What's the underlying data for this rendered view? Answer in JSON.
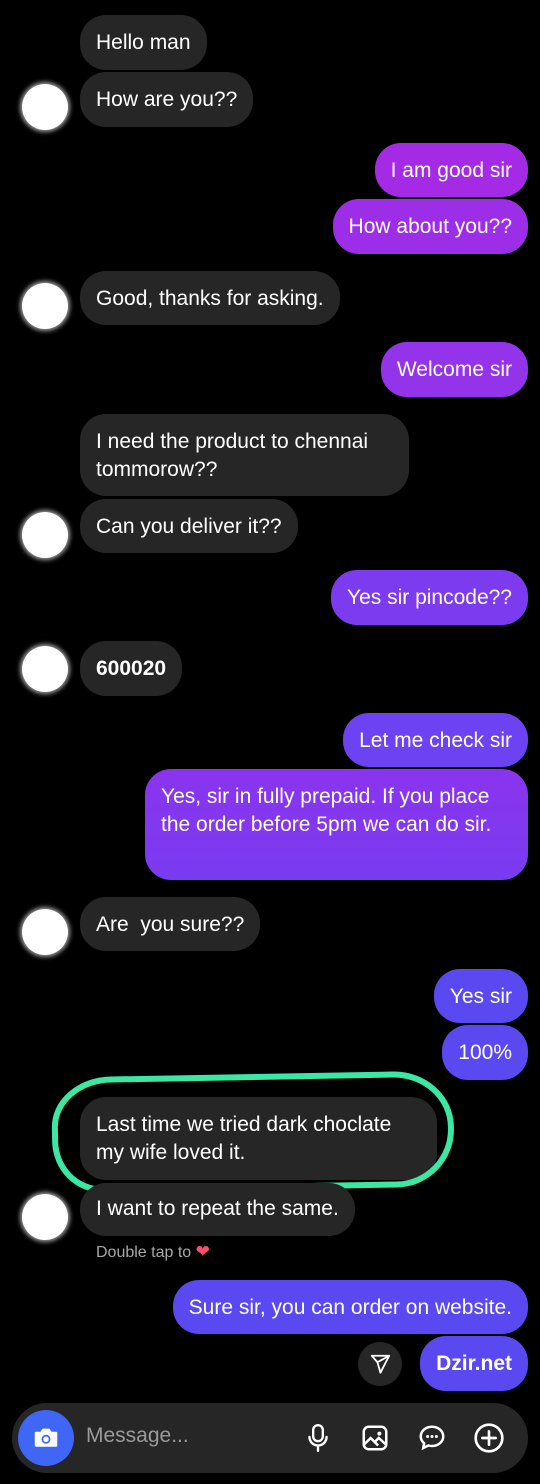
{
  "messages": [
    {
      "text": "Hello man",
      "from": "them"
    },
    {
      "text": "How are you??",
      "from": "them"
    },
    {
      "text": "I am good sir",
      "from": "me"
    },
    {
      "text": "How about you??",
      "from": "me"
    },
    {
      "text": "Good, thanks for asking.",
      "from": "them"
    },
    {
      "text": "Welcome sir",
      "from": "me"
    },
    {
      "text": "I need the product to chennai tommorow??",
      "from": "them"
    },
    {
      "text": "Can you deliver it??",
      "from": "them"
    },
    {
      "text": "Yes sir pincode??",
      "from": "me"
    },
    {
      "text": "600020",
      "from": "them"
    },
    {
      "text": "Let me check sir",
      "from": "me"
    },
    {
      "text": "Yes, sir in fully prepaid. If you place the order before 5pm we can do sir.",
      "from": "me"
    },
    {
      "text": "Are  you sure??",
      "from": "them"
    },
    {
      "text": "Yes sir",
      "from": "me"
    },
    {
      "text": "100%",
      "from": "me"
    },
    {
      "text": "Last time we tried dark choclate my wife loved it.",
      "from": "them"
    },
    {
      "text": "I want to repeat the same.",
      "from": "them"
    },
    {
      "text": "Sure sir, you can order on website.",
      "from": "me"
    },
    {
      "text": "Dzir.net",
      "from": "me"
    }
  ],
  "reaction_hint": {
    "text": "Double tap to",
    "emoji": "❤"
  },
  "composer": {
    "placeholder": "Message..."
  },
  "icons": [
    "camera-icon",
    "microphone-icon",
    "gallery-icon",
    "sticker-icon",
    "plus-icon",
    "share-icon"
  ],
  "colors": {
    "outgoing_top": "#a52ae6",
    "outgoing_bottom": "#5a48f0",
    "incoming": "#262626",
    "highlight": "#3ce6a3",
    "camera_button": "#3f66f5"
  }
}
